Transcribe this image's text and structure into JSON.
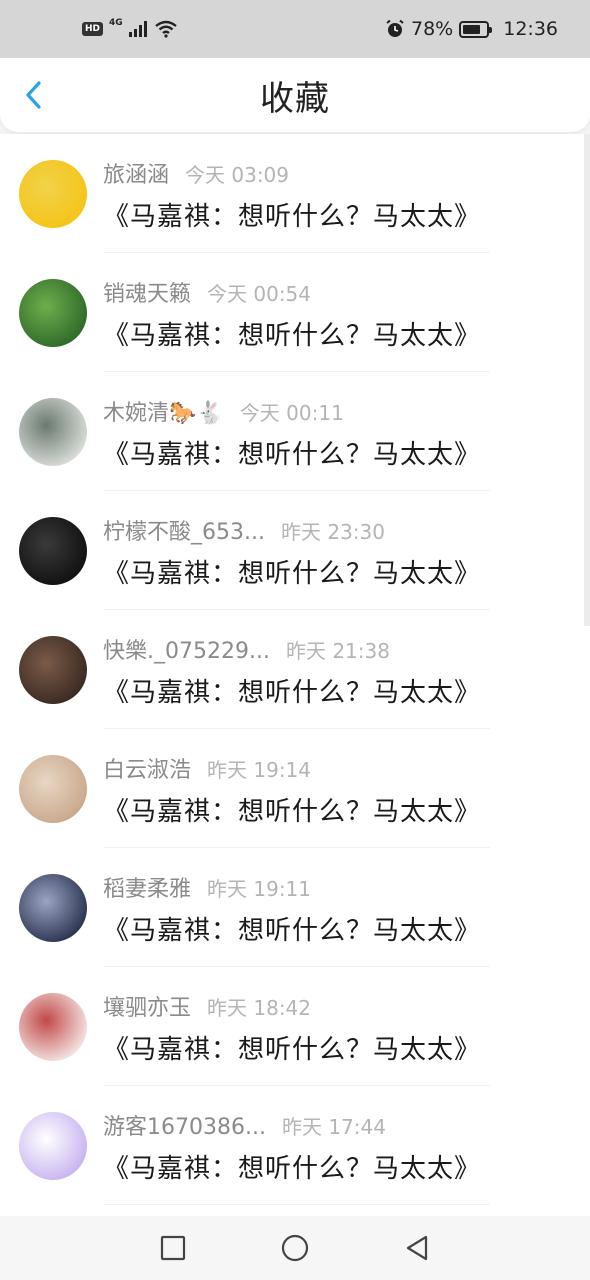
{
  "status_bar": {
    "hd": "HD",
    "network": "4G",
    "alarm_icon": "alarm-clock-icon",
    "battery_text": "78%",
    "battery_level": 0.78,
    "time": "12:36"
  },
  "header": {
    "title": "收藏",
    "back_icon": "chevron-left-icon",
    "accent": "#2aa3e6"
  },
  "items": [
    {
      "name": "旅涵涵",
      "time": "今天 03:09",
      "message": "《马嘉祺：想听什么？马太太》",
      "avatar_colors": [
        "#f5c518",
        "#f0d24a"
      ]
    },
    {
      "name": "销魂天籁",
      "time": "今天 00:54",
      "message": "《马嘉祺：想听什么？马太太》",
      "avatar_colors": [
        "#2f6b2a",
        "#6fae4c"
      ]
    },
    {
      "name": "木婉清🐎🐇",
      "time": "今天 00:11",
      "message": "《马嘉祺：想听什么？马太太》",
      "avatar_colors": [
        "#d9dcd8",
        "#6a7a70"
      ]
    },
    {
      "name": "柠檬不酸_653...",
      "time": "昨天 23:30",
      "message": "《马嘉祺：想听什么？马太太》",
      "avatar_colors": [
        "#111111",
        "#3a3a3a"
      ]
    },
    {
      "name": "快樂._075229...",
      "time": "昨天 21:38",
      "message": "《马嘉祺：想听什么？马太太》",
      "avatar_colors": [
        "#3b2a22",
        "#7a5b48"
      ]
    },
    {
      "name": "白云淑浩",
      "time": "昨天 19:14",
      "message": "《马嘉祺：想听什么？马太太》",
      "avatar_colors": [
        "#c9a98c",
        "#e8d6c4"
      ]
    },
    {
      "name": "稻妻柔雅",
      "time": "昨天 19:11",
      "message": "《马嘉祺：想听什么？马太太》",
      "avatar_colors": [
        "#2c3550",
        "#9ba4c4"
      ]
    },
    {
      "name": "壤驷亦玉",
      "time": "昨天 18:42",
      "message": "《马嘉祺：想听什么？马太太》",
      "avatar_colors": [
        "#f3e4e2",
        "#c24848"
      ]
    },
    {
      "name": "游客1670386...",
      "time": "昨天 17:44",
      "message": "《马嘉祺：想听什么？马太太》",
      "avatar_colors": [
        "#c8b4f0",
        "#ffffff"
      ]
    }
  ],
  "nav": {
    "recent_icon": "square-icon",
    "home_icon": "circle-icon",
    "back_icon": "triangle-back-icon"
  }
}
